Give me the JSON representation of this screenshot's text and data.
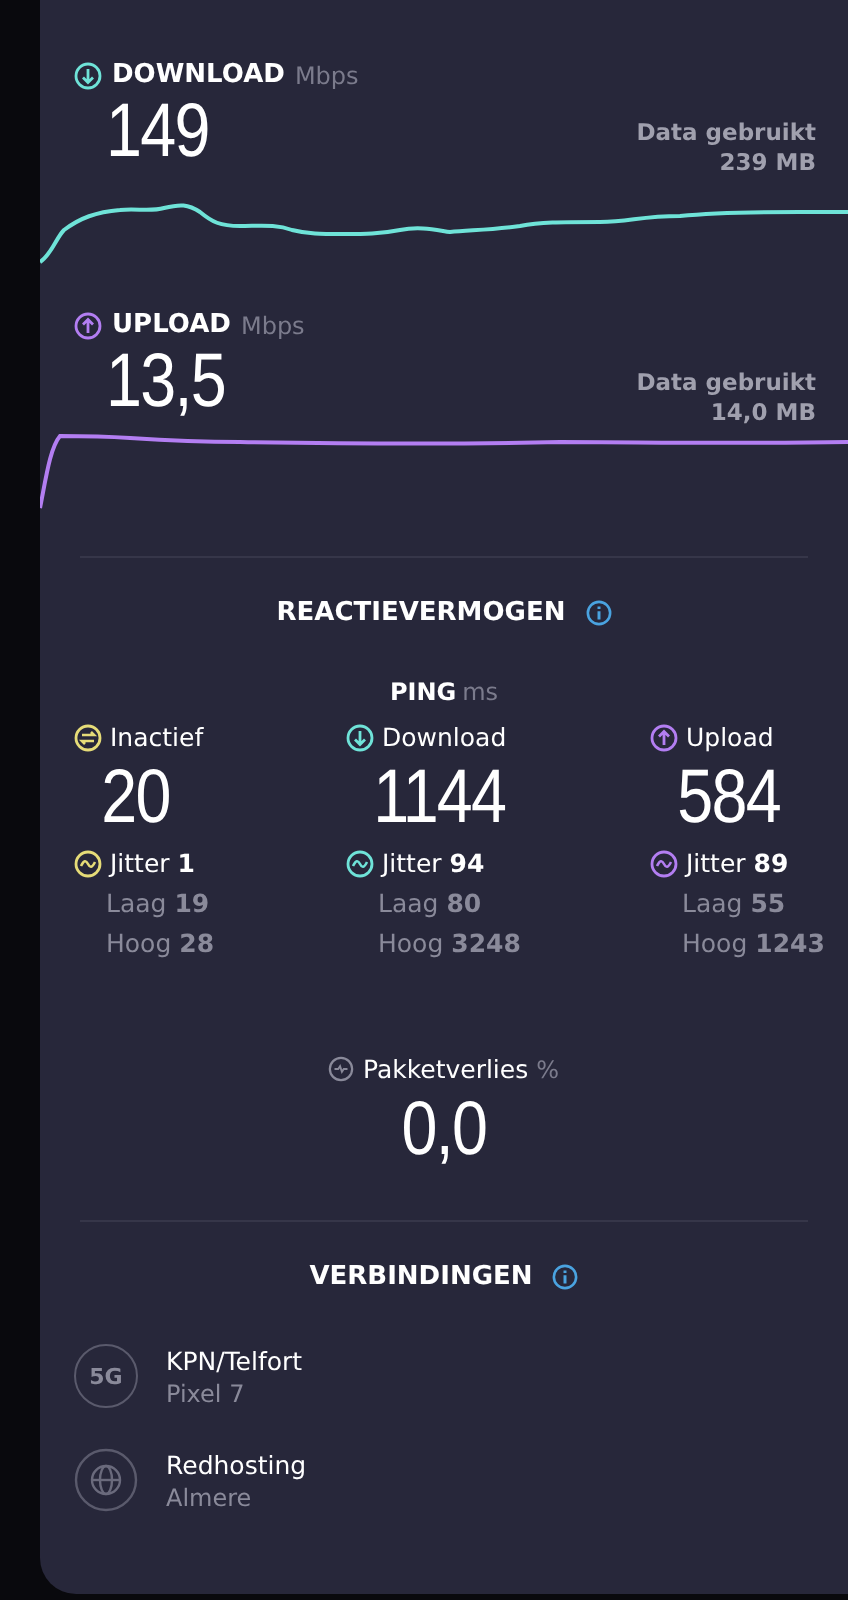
{
  "speeds": [
    {
      "kind": "download",
      "label": "DOWNLOAD",
      "unit": "Mbps",
      "value": "149",
      "data_label": "Data gebruikt",
      "data_value": "239 MB"
    },
    {
      "kind": "upload",
      "label": "UPLOAD",
      "unit": "Mbps",
      "value": "13,5",
      "data_label": "Data gebruikt",
      "data_value": "14,0 MB"
    }
  ],
  "responsiveness": {
    "title": "REACTIEVERMOGEN",
    "ping_label": "PING",
    "ping_unit": "ms",
    "columns": [
      {
        "kind": "idle",
        "label": "Inactief",
        "value": "20",
        "jitter_label": "Jitter",
        "jitter": "1",
        "low_label": "Laag",
        "low": "19",
        "high_label": "Hoog",
        "high": "28"
      },
      {
        "kind": "download",
        "label": "Download",
        "value": "1144",
        "jitter_label": "Jitter",
        "jitter": "94",
        "low_label": "Laag",
        "low": "80",
        "high_label": "Hoog",
        "high": "3248"
      },
      {
        "kind": "upload",
        "label": "Upload",
        "value": "584",
        "jitter_label": "Jitter",
        "jitter": "89",
        "low_label": "Laag",
        "low": "55",
        "high_label": "Hoog",
        "high": "1243"
      }
    ]
  },
  "packet_loss": {
    "label": "Pakketverlies",
    "unit": "%",
    "value": "0,0"
  },
  "connections": {
    "title": "VERBINDINGEN",
    "items": [
      {
        "kind": "network",
        "badge": "5G",
        "name": "KPN/Telfort",
        "detail": "Pixel 7"
      },
      {
        "kind": "server",
        "name": "Redhosting",
        "detail": "Almere"
      }
    ]
  }
}
